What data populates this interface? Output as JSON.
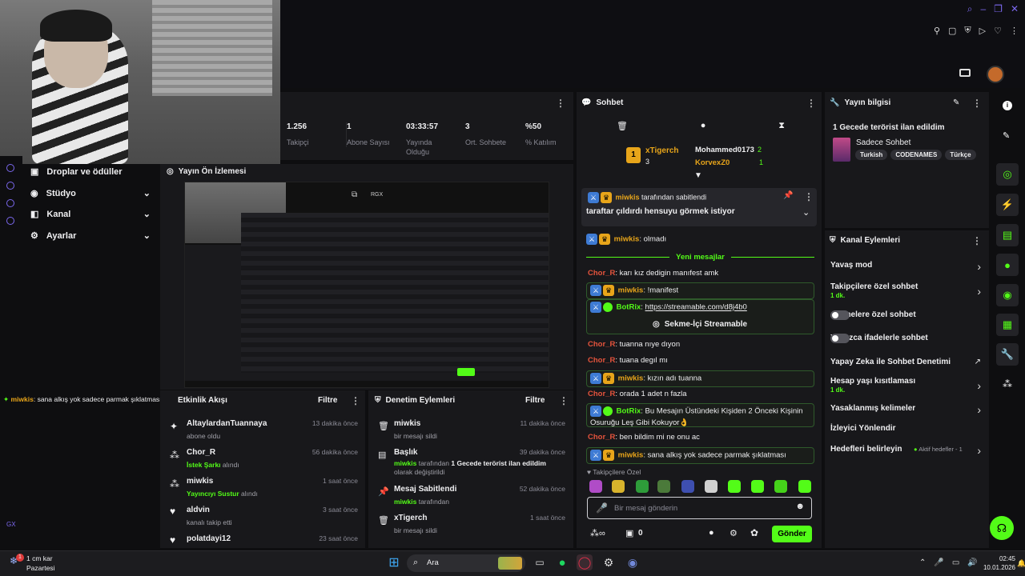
{
  "top_right_icons": [
    "search-icon",
    "minimize-icon",
    "maximize-icon",
    "close-icon"
  ],
  "stats": [
    {
      "value": "1.256",
      "label": "Takipçi"
    },
    {
      "value": "1",
      "label": "Abone Sayısı"
    },
    {
      "value": "03:33:57",
      "label": "Yayında Olduğu"
    },
    {
      "value": "3",
      "label": "Ort. Sohbete"
    },
    {
      "value": "%50",
      "label": "% Katılım"
    }
  ],
  "sidebar": {
    "items": [
      {
        "label": "Droplar ve ödüller"
      },
      {
        "label": "Stüdyo"
      },
      {
        "label": "Kanal"
      },
      {
        "label": "Ayarlar"
      }
    ]
  },
  "preview": {
    "title": "Yayın Ön İzlemesi",
    "rgx": "RGX"
  },
  "overlay_chat": {
    "user": "miwkis",
    "text": ": sana alkış yok sadece parmak şıklatması"
  },
  "activity": {
    "title": "Etkinlik Akışı",
    "filter": "Filtre",
    "items": [
      {
        "name": "AltaylardanTuannaya",
        "sub": "abone oldu",
        "time": "13 dakika önce"
      },
      {
        "name": "Chor_R",
        "sub_green": "İstek Şarkı",
        "sub": "alındı",
        "time": "56 dakika önce"
      },
      {
        "name": "miwkis",
        "sub_green": "Yayıncıyı Sustur",
        "sub": "alındı",
        "time": "1 saat önce"
      },
      {
        "name": "aldvin",
        "sub": "kanalı takip etti",
        "time": "3 saat önce"
      },
      {
        "name": "polatdayi12",
        "sub": "",
        "time": "23 saat önce"
      }
    ]
  },
  "moderation": {
    "title": "Denetim Eylemleri",
    "filter": "Filtre",
    "items": [
      {
        "name": "miwkis",
        "sub": "bir mesajı sildi",
        "time": "11 dakika önce"
      },
      {
        "name": "Başlık",
        "sub_pre": "miwkis",
        "sub_mid": " tarafından ",
        "sub_bold": "1 Gecede terörist ilan edildim",
        "sub": " olarak değiştirildi",
        "time": "39 dakika önce"
      },
      {
        "name": "Mesaj Sabitlendi",
        "sub_pre": "miwkis",
        "sub": " tarafından",
        "time": "52 dakika önce"
      },
      {
        "name": "xTigerch",
        "sub": "bir mesajı sildi",
        "time": "1 saat önce"
      }
    ]
  },
  "chat": {
    "title": "Sohbet",
    "top_gifters": [
      {
        "name": "xTigerch",
        "count": "3",
        "rank": "1"
      },
      {
        "name": "Mohammed0173",
        "count": "2"
      },
      {
        "name": "KorvexZ0",
        "count": "1"
      }
    ],
    "pinned": {
      "user": "miwkis",
      "suffix": " tarafından sabitlendi",
      "text": "taraftar çıldırdı hensuyu görmek istiyor"
    },
    "new_messages": "Yeni mesajlar",
    "messages": [
      {
        "user": "miwkis",
        "text": ": olmadı",
        "style": "gold"
      },
      {
        "user": "Chor_R",
        "text": ": karı kız dedigin manıfest amk",
        "style": "red"
      },
      {
        "user": "miwkis",
        "text": ": !manifest",
        "style": "gold"
      },
      {
        "user": "BotRix",
        "text": ": ",
        "link": "https://streamable.com/d8j4b0",
        "style": "bot"
      },
      {
        "user": "Chor_R",
        "text": ": tuanna nıye dıyon",
        "style": "red"
      },
      {
        "user": "Chor_R",
        "text": ": tuana degıl mı",
        "style": "red"
      },
      {
        "user": "miwkis",
        "text": ": kızın adı tuanna",
        "style": "gold"
      },
      {
        "user": "Chor_R",
        "text": ": orada 1 adet n fazla",
        "style": "red"
      },
      {
        "user": "BotRix",
        "text": ": Bu Mesajın Üstündeki Kişiden 2 Önceki Kişinin Osuruğu Leş Gibi Kokuyor👌",
        "style": "bot"
      },
      {
        "user": "Chor_R",
        "text": ": ben bildim mi ne onu ac",
        "style": "red"
      },
      {
        "user": "miwkis",
        "text": ": sana alkış yok sadece parmak şıklatması",
        "style": "gold"
      }
    ],
    "streamable_button": "Sekme-İçi Streamable",
    "followers_only": "Takipçilere Özel",
    "input_placeholder": "Bir mesaj gönderin",
    "points": "0",
    "send": "Gönder"
  },
  "stream_info": {
    "title": "Yayın bilgisi",
    "stream_title": "1 Gecede terörist ilan edildim",
    "category": "Sadece Sohbet",
    "tags": [
      "Turkish",
      "CODENAMES",
      "Türkçe"
    ]
  },
  "channel_actions": {
    "title": "Kanal Eylemleri",
    "items": [
      {
        "label": "Yavaş mod",
        "control": "chevron"
      },
      {
        "label": "Takipçilere özel sohbet",
        "sub": "1 dk.",
        "control": "chevron"
      },
      {
        "label": "Abonelere özel sohbet",
        "control": "toggle"
      },
      {
        "label": "Yalnızca ifadelerle sohbet",
        "control": "toggle"
      },
      {
        "label": "Yapay Zeka ile Sohbet Denetimi",
        "control": "external"
      },
      {
        "label": "Hesap yaşı kısıtlaması",
        "sub": "1 dk.",
        "control": "chevron"
      },
      {
        "label": "Yasaklanmış kelimeler",
        "control": "chevron"
      },
      {
        "label": "İzleyici Yönlendir",
        "control": "none"
      },
      {
        "label": "Hedefleri belirleyin",
        "control": "goals",
        "goals_text": "Aktif hedefler - 1"
      }
    ]
  },
  "taskbar": {
    "weather_temp": "1 cm kar",
    "weather_day": "Pazartesi",
    "search": "Ara",
    "time": "02:45",
    "date": "10.01.2026",
    "notif_count": "1"
  },
  "gx_label": "GX",
  "colors": {
    "accent": "#53fc18",
    "panel": "#18181b",
    "bg": "#0e0e10"
  }
}
